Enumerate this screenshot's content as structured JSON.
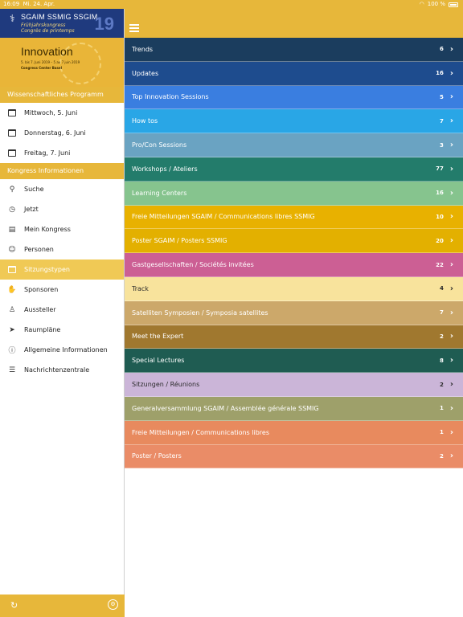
{
  "status": {
    "time": "16:09",
    "date": "Mi. 24. Apr.",
    "battery": "100 %"
  },
  "banner": {
    "org": "SGAIM SSMIG SSGIM",
    "sub1": "Frühjahrskongress",
    "sub2": "Congrès de printemps",
    "year": "19",
    "title": "Innovation",
    "dates": "5. bis 7. Juni 2019 – 5 au 7 juin 2019",
    "venue": "Congress Center Basel"
  },
  "sidebar": {
    "section1": "Wissenschaftliches Programm",
    "days": [
      {
        "label": "Mittwoch, 5. Juni"
      },
      {
        "label": "Donnerstag, 6. Juni"
      },
      {
        "label": "Freitag, 7. Juni"
      }
    ],
    "section2": "Kongress Informationen",
    "items": [
      {
        "label": "Suche",
        "icon": "search-icon",
        "glyph": "⚲"
      },
      {
        "label": "Jetzt",
        "icon": "clock-icon",
        "glyph": "◷"
      },
      {
        "label": "Mein Kongress",
        "icon": "book-icon",
        "glyph": "▤"
      },
      {
        "label": "Personen",
        "icon": "person-icon",
        "glyph": "☺"
      },
      {
        "label": "Sitzungstypen",
        "icon": "calendar-icon",
        "glyph": "▭",
        "selected": true
      },
      {
        "label": "Sponsoren",
        "icon": "handshake-icon",
        "glyph": "✋"
      },
      {
        "label": "Aussteller",
        "icon": "exhibitor-icon",
        "glyph": "♙"
      },
      {
        "label": "Raumpläne",
        "icon": "location-icon",
        "glyph": "➤"
      },
      {
        "label": "Allgemeine Informationen",
        "icon": "info-icon",
        "glyph": "ⓘ"
      },
      {
        "label": "Nachrichtenzentrale",
        "icon": "rss-icon",
        "glyph": "☰"
      }
    ]
  },
  "colors": {
    "accent": "#e7b73a",
    "rows": [
      "#1b3d5e",
      "#1e4c8e",
      "#3a7ee0",
      "#29a6e6",
      "#6aa3c2",
      "#237c6b",
      "#86c48e",
      "#e8b100",
      "#e3b000",
      "#cc5f94",
      "#f8e39c",
      "#cca86a",
      "#a0782f",
      "#1f5c52",
      "#cbb5d8",
      "#9ea06a",
      "#e88a5e",
      "#ea8c67"
    ]
  },
  "rows": [
    {
      "label": "Trends",
      "count": "6"
    },
    {
      "label": "Updates",
      "count": "16"
    },
    {
      "label": "Top Innovation Sessions",
      "count": "5"
    },
    {
      "label": "How tos",
      "count": "7"
    },
    {
      "label": "Pro/Con Sessions",
      "count": "3"
    },
    {
      "label": "Workshops / Ateliers",
      "count": "77"
    },
    {
      "label": "Learning Centers",
      "count": "16"
    },
    {
      "label": "Freie Mitteilungen SGAIM / Communications libres SSMIG",
      "count": "10"
    },
    {
      "label": "Poster SGAIM / Posters SSMIG",
      "count": "20"
    },
    {
      "label": "Gastgesellschaften / Sociétés invitées",
      "count": "22"
    },
    {
      "label": "Track",
      "count": "4"
    },
    {
      "label": "Satelliten Symposien / Symposia satellites",
      "count": "7"
    },
    {
      "label": "Meet the Expert",
      "count": "2"
    },
    {
      "label": "Special Lectures",
      "count": "8"
    },
    {
      "label": "Sitzungen / Réunions",
      "count": "2"
    },
    {
      "label": "Generalversammlung SGAIM / Assemblée générale SSMIG",
      "count": "1"
    },
    {
      "label": "Freie Mitteilungen / Communications libres",
      "count": "1"
    },
    {
      "label": "Poster / Posters",
      "count": "2"
    }
  ]
}
